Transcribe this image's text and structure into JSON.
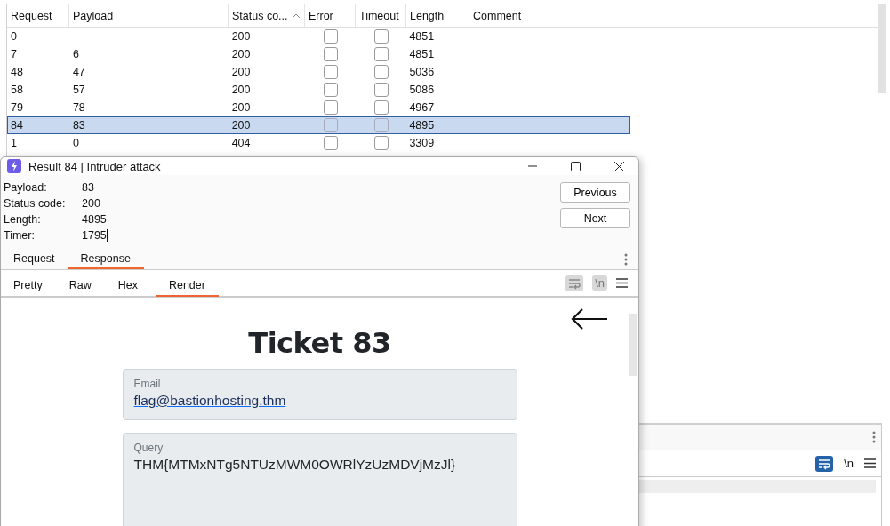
{
  "table": {
    "columns": [
      {
        "label": "Request",
        "sorted": false
      },
      {
        "label": "Payload",
        "sorted": false
      },
      {
        "label": "Status co...",
        "sorted": true
      },
      {
        "label": "Error",
        "sorted": false
      },
      {
        "label": "Timeout",
        "sorted": false
      },
      {
        "label": "Length",
        "sorted": false
      },
      {
        "label": "Comment",
        "sorted": false
      }
    ],
    "rows": [
      {
        "request": "0",
        "status": "200",
        "error": false,
        "timeout": false,
        "length": "4851",
        "selected": false
      },
      {
        "request": "7",
        "payload": "6",
        "status": "200",
        "error": false,
        "timeout": false,
        "length": "4851",
        "selected": false
      },
      {
        "request": "48",
        "payload": "47",
        "status": "200",
        "error": false,
        "timeout": false,
        "length": "5036",
        "selected": false
      },
      {
        "request": "58",
        "payload": "57",
        "status": "200",
        "error": false,
        "timeout": false,
        "length": "5086",
        "selected": false
      },
      {
        "request": "79",
        "payload": "78",
        "status": "200",
        "error": false,
        "timeout": false,
        "length": "4967",
        "selected": false
      },
      {
        "request": "84",
        "payload": "83",
        "status": "200",
        "error": false,
        "timeout": false,
        "length": "4895",
        "selected": true
      },
      {
        "request": "1",
        "payload": "0",
        "status": "404",
        "error": false,
        "timeout": false,
        "length": "3309",
        "selected": false
      }
    ]
  },
  "background_editor": {
    "wrap": true,
    "newline_label": "\\n"
  },
  "dialog": {
    "title": "Result 84 | Intruder attack",
    "fields": [
      {
        "label": "Payload:",
        "value": "83"
      },
      {
        "label": "Status code:",
        "value": "200"
      },
      {
        "label": "Length:",
        "value": "4895"
      },
      {
        "label": "Timer:",
        "value": "1795"
      }
    ],
    "buttons": [
      "Previous",
      "Next"
    ],
    "tabs": [
      {
        "label": "Request",
        "selected": false
      },
      {
        "label": "Response",
        "selected": true
      }
    ],
    "view_tabs": [
      {
        "label": "Pretty",
        "selected": false
      },
      {
        "label": "Raw",
        "selected": false
      },
      {
        "label": "Hex",
        "selected": false
      },
      {
        "label": "Render",
        "selected": true
      }
    ],
    "wrap": false,
    "newline_label": "\\n",
    "render": {
      "heading": "Ticket 83",
      "cards": [
        {
          "kind": "link",
          "label": "Email",
          "value": "flag@bastionhosting.thm"
        },
        {
          "kind": "text",
          "label": "Query",
          "value": "THM{MTMxNTg5NTUzMWM0OWRlYzUzMDVjMzJl}"
        }
      ]
    }
  }
}
